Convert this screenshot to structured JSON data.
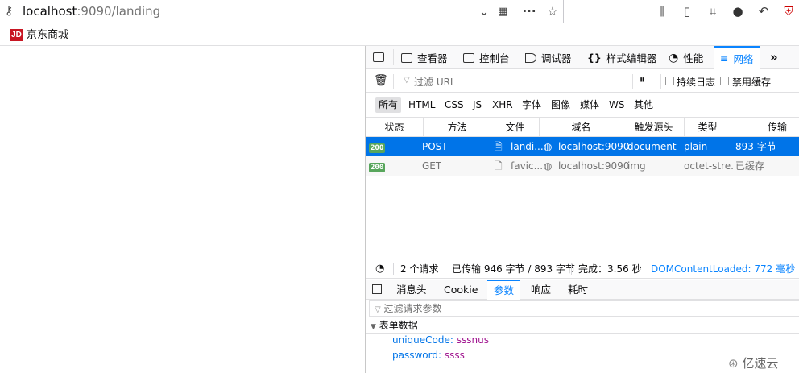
{
  "urlbar": {
    "host": "localhost",
    "rest": ":9090/landing"
  },
  "bookmarks": [
    {
      "logo": "JD",
      "label": "京东商城"
    }
  ],
  "devtools": {
    "tabs": [
      "查看器",
      "控制台",
      "调试器",
      "样式编辑器",
      "性能",
      "网络"
    ],
    "active_tab": "网络",
    "filter_placeholder": "过滤 URL",
    "persist_logs": "持续日志",
    "disable_cache": "禁用缓存",
    "pause_symbol": "⏸",
    "type_filters": [
      "所有",
      "HTML",
      "CSS",
      "JS",
      "XHR",
      "字体",
      "图像",
      "媒体",
      "WS",
      "其他"
    ],
    "columns": [
      "状态",
      "方法",
      "文件",
      "域名",
      "触发源头",
      "类型",
      "传输"
    ],
    "requests": [
      {
        "status": "200",
        "method": "POST",
        "file": "landi...",
        "domain": "localhost:9090",
        "cause": "document",
        "type": "plain",
        "transferred": "893 字节"
      },
      {
        "status": "200",
        "method": "GET",
        "file": "favic...",
        "domain": "localhost:9090",
        "cause": "img",
        "type": "octet-stre...",
        "transferred": "已缓存"
      }
    ],
    "statusbar": {
      "requests": "2 个请求",
      "transferred": "已传输 946 字节 / 893 字节",
      "finish": "完成：3.56 秒",
      "dcl": "DOMContentLoaded: 772 毫秒"
    },
    "detail_tabs": [
      "消息头",
      "Cookie",
      "参数",
      "响应",
      "耗时"
    ],
    "detail_active": "参数",
    "params_filter_placeholder": "过滤请求参数",
    "form_section": "表单数据",
    "form_data": [
      {
        "key": "uniqueCode:",
        "value": "sssnus"
      },
      {
        "key": "password:",
        "value": "ssss"
      }
    ]
  },
  "watermark": "亿速云",
  "colors": {
    "accent": "#0a84ff",
    "selected_row": "#0074e8",
    "status_ok": "#58a65c",
    "param_value": "#a0138f"
  }
}
